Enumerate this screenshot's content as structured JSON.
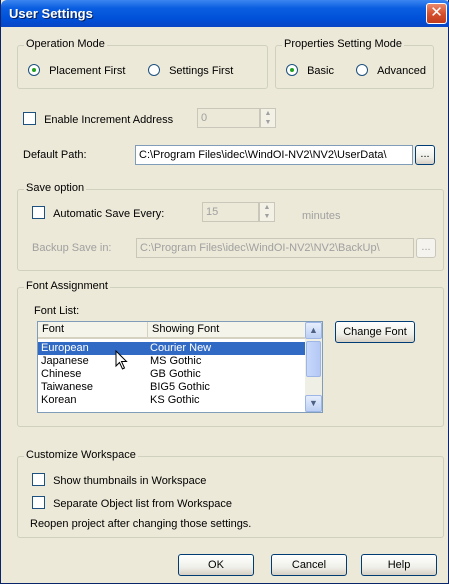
{
  "window": {
    "title": "User Settings",
    "close_glyph": "✕"
  },
  "operation_mode": {
    "legend": "Operation Mode",
    "placement_first": "Placement First",
    "settings_first": "Settings First",
    "selected": "placement_first"
  },
  "properties_mode": {
    "legend": "Properties Setting Mode",
    "basic": "Basic",
    "advanced": "Advanced",
    "selected": "basic"
  },
  "increment": {
    "label": "Enable Increment Address",
    "value": "0",
    "checked": false
  },
  "default_path": {
    "label": "Default Path:",
    "value": "C:\\Program Files\\idec\\WindOI-NV2\\NV2\\UserData\\",
    "browse": "..."
  },
  "save_option": {
    "legend": "Save option",
    "auto_save_label": "Automatic Save Every:",
    "auto_save_value": "15",
    "minutes": "minutes",
    "backup_label": "Backup Save in:",
    "backup_value": "C:\\Program Files\\idec\\WindOI-NV2\\NV2\\BackUp\\",
    "browse": "..."
  },
  "font_assignment": {
    "legend": "Font Assignment",
    "list_label": "Font List:",
    "columns": [
      "Font",
      "Showing Font"
    ],
    "rows": [
      [
        "European",
        "Courier New"
      ],
      [
        "Japanese",
        "MS Gothic"
      ],
      [
        "Chinese",
        "GB Gothic"
      ],
      [
        "Taiwanese",
        "BIG5 Gothic"
      ],
      [
        "Korean",
        "KS Gothic"
      ]
    ],
    "selected_row": 0,
    "change_font": "Change Font"
  },
  "workspace": {
    "legend": "Customize Workspace",
    "show_thumbnails": "Show thumbnails in Workspace",
    "separate_object": "Separate Object list from Workspace",
    "note": "Reopen project after changing those settings."
  },
  "buttons": {
    "ok": "OK",
    "cancel": "Cancel",
    "help": "Help"
  },
  "colors": {
    "title_bar": "#0a5ee0",
    "selection": "#316ac5",
    "dialog_bg": "#ece9d8"
  }
}
